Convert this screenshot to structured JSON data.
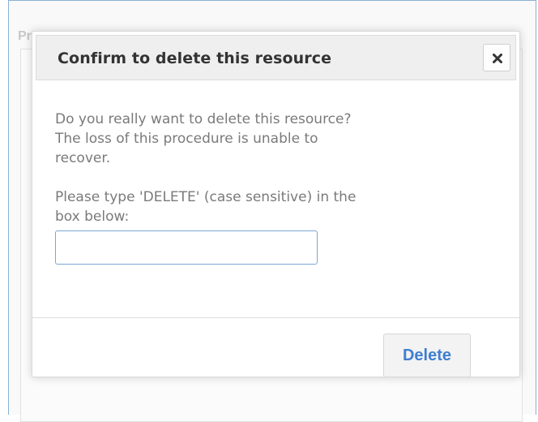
{
  "background": {
    "panel_title_fragment": "Pr"
  },
  "dialog": {
    "title": "Confirm to delete this resource",
    "close_icon": "close-icon",
    "message_lines": [
      "Do you really want to delete this resource?",
      "The loss of this procedure is unable to",
      "recover."
    ],
    "confirm_lines": [
      "Please type 'DELETE' (case sensitive) in the",
      "box below:"
    ],
    "input": {
      "value": "",
      "placeholder": ""
    },
    "delete_label": "Delete"
  },
  "colors": {
    "accent": "#3f7fcf",
    "input_border": "#7ba7d4",
    "header_bg": "#efefef"
  }
}
